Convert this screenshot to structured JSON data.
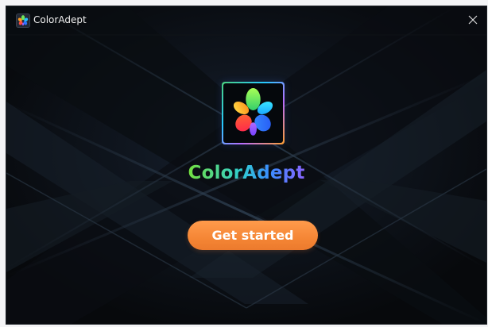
{
  "window": {
    "title": "ColorAdept",
    "close_label": "Close",
    "title_icon": "coloradept-logo-icon"
  },
  "main": {
    "logo_icon": "coloradept-petal-logo-icon",
    "app_name": "ColorAdept",
    "primary_button": "Get started"
  },
  "colors": {
    "window_background": "#0b0d10",
    "primary_button": "#f58635",
    "brand_gradient": [
      "#74e03e",
      "#30cfd0",
      "#3b8cff",
      "#8a64ff"
    ],
    "logo_border_gradient": [
      "#4ad07c",
      "#26c8ff",
      "#b76dff",
      "#ff9f2e"
    ]
  }
}
